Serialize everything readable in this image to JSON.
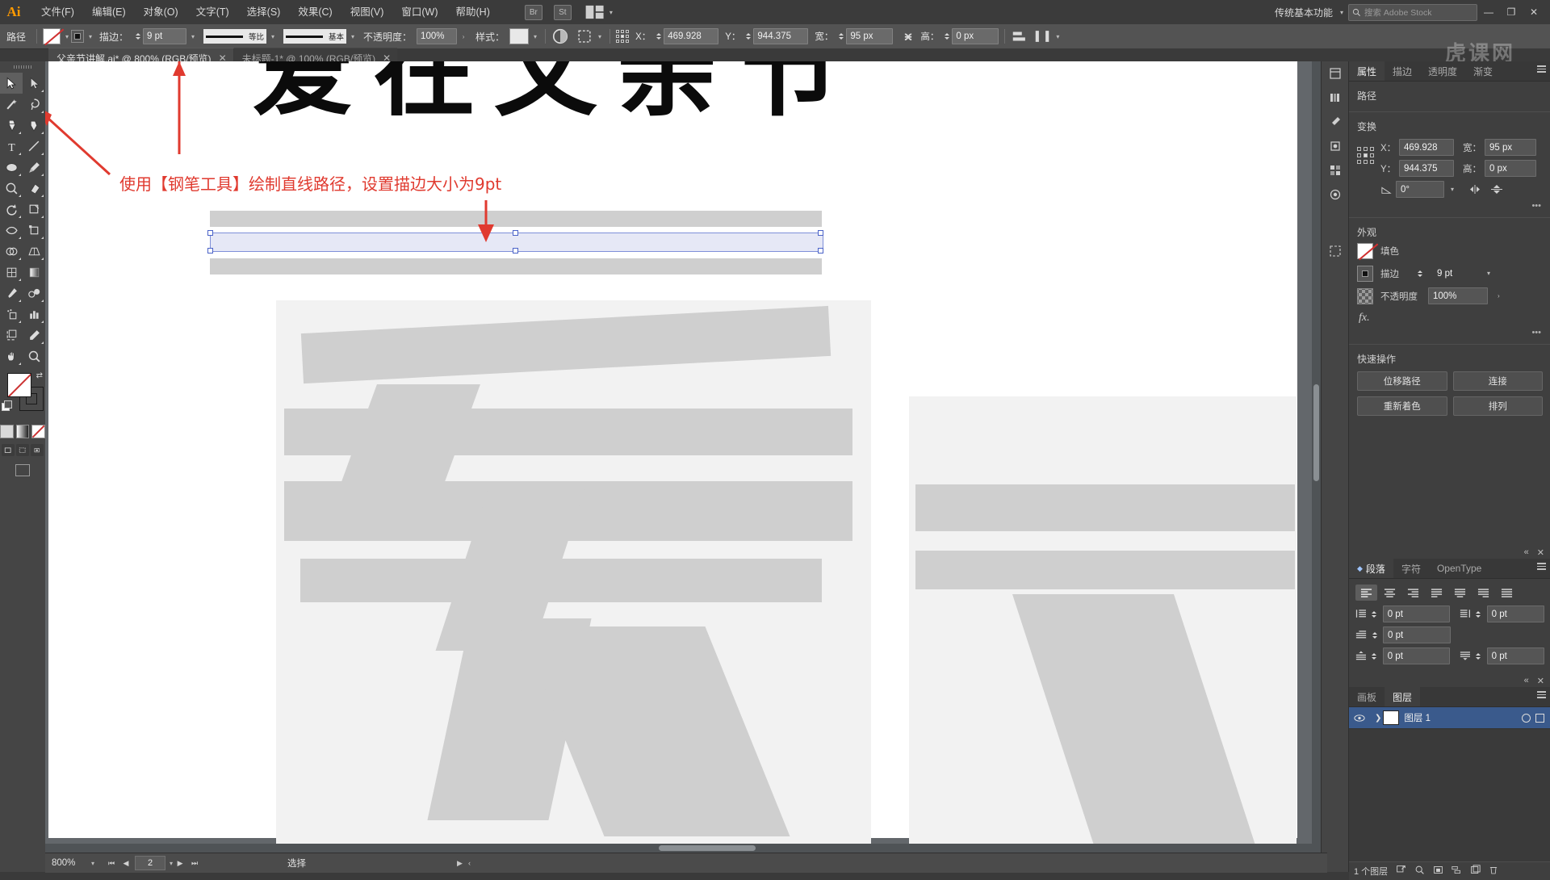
{
  "app": {
    "name": "Adobe Illustrator",
    "logo_text": "Ai",
    "workspace": "传统基本功能",
    "stock_search_placeholder": "搜索 Adobe Stock",
    "accent_color": "#ff9a00",
    "selection_color": "#4a62c8"
  },
  "menubar": {
    "items": [
      {
        "label": "文件(F)"
      },
      {
        "label": "编辑(E)"
      },
      {
        "label": "对象(O)"
      },
      {
        "label": "文字(T)"
      },
      {
        "label": "选择(S)"
      },
      {
        "label": "效果(C)"
      },
      {
        "label": "视图(V)"
      },
      {
        "label": "窗口(W)"
      },
      {
        "label": "帮助(H)"
      }
    ],
    "window_buttons": {
      "minimize": "—",
      "restore": "❐",
      "close": "✕"
    }
  },
  "controlbar": {
    "object_label": "路径",
    "fill_label": "填色",
    "stroke_label": "描边：",
    "stroke_weight": "9 pt",
    "stroke_profile": "等比",
    "brush_definition": "基本",
    "opacity_label": "不透明度：",
    "opacity_value": "100%",
    "style_label": "样式：",
    "x_label": "X：",
    "x_value": "469.928",
    "y_label": "Y：",
    "y_value": "944.375",
    "w_label": "宽：",
    "w_value": "95 px",
    "h_label": "高：",
    "h_value": "0 px"
  },
  "tabs": [
    {
      "label": "父亲节讲解.ai* @ 800% (RGB/预览)",
      "active": true,
      "close": "✕"
    },
    {
      "label": "未标题-1* @ 100% (RGB/预览)",
      "active": false,
      "close": "✕"
    }
  ],
  "toolbar": {
    "tools": [
      {
        "name": "selection-tool",
        "selected": true
      },
      {
        "name": "direct-selection-tool",
        "selected": false
      },
      {
        "name": "magic-wand-tool",
        "selected": false
      },
      {
        "name": "lasso-tool",
        "selected": false
      },
      {
        "name": "pen-tool",
        "selected": false
      },
      {
        "name": "curvature-tool",
        "selected": false
      },
      {
        "name": "type-tool",
        "selected": false
      },
      {
        "name": "line-segment-tool",
        "selected": false
      },
      {
        "name": "ellipse-tool",
        "selected": false
      },
      {
        "name": "paintbrush-tool",
        "selected": false
      },
      {
        "name": "shaper-tool",
        "selected": false
      },
      {
        "name": "eraser-tool",
        "selected": false
      },
      {
        "name": "rotate-tool",
        "selected": false
      },
      {
        "name": "scale-tool",
        "selected": false
      },
      {
        "name": "width-tool",
        "selected": false
      },
      {
        "name": "free-transform-tool",
        "selected": false
      },
      {
        "name": "shape-builder-tool",
        "selected": false
      },
      {
        "name": "perspective-grid-tool",
        "selected": false
      },
      {
        "name": "mesh-tool",
        "selected": false
      },
      {
        "name": "gradient-tool",
        "selected": false
      },
      {
        "name": "eyedropper-tool",
        "selected": false
      },
      {
        "name": "blend-tool",
        "selected": false
      },
      {
        "name": "symbol-sprayer-tool",
        "selected": false
      },
      {
        "name": "column-graph-tool",
        "selected": false
      },
      {
        "name": "artboard-tool",
        "selected": false
      },
      {
        "name": "slice-tool",
        "selected": false
      },
      {
        "name": "hand-tool",
        "selected": false
      },
      {
        "name": "zoom-tool",
        "selected": false
      }
    ],
    "fill_label": "填色",
    "stroke_label": "描边"
  },
  "canvas": {
    "annotation": "使用【钢笔工具】绘制直线路径，设置描边大小为9pt",
    "headline_chars": "爱在父亲节",
    "background_char": "爱",
    "watermark": "虎课网"
  },
  "properties_panel": {
    "tabs": [
      {
        "label": "属性",
        "active": true
      },
      {
        "label": "描边",
        "active": false
      },
      {
        "label": "透明度",
        "active": false
      },
      {
        "label": "渐变",
        "active": false
      }
    ],
    "object_type": "路径",
    "transform": {
      "title": "变换",
      "x_label": "X：",
      "x_value": "469.928",
      "y_label": "Y：",
      "y_value": "944.375",
      "w_label": "宽：",
      "w_value": "95 px",
      "h_label": "高：",
      "h_value": "0 px",
      "angle_value": "0°"
    },
    "appearance": {
      "title": "外观",
      "fill_label": "填色",
      "stroke_label": "描边",
      "stroke_value": "9 pt",
      "opacity_label": "不透明度",
      "opacity_value": "100%",
      "fx_label": "fx."
    },
    "quick_actions": {
      "title": "快速操作",
      "buttons": [
        {
          "label": "位移路径"
        },
        {
          "label": "连接"
        },
        {
          "label": "重新着色"
        },
        {
          "label": "排列"
        }
      ]
    }
  },
  "paragraph_panel": {
    "tabs": [
      {
        "label": "段落",
        "active": true
      },
      {
        "label": "字符",
        "active": false
      },
      {
        "label": "OpenType",
        "active": false
      }
    ],
    "alignment": [
      "align-left",
      "align-center",
      "align-right",
      "justify-last-left",
      "justify-last-center",
      "justify-last-right",
      "justify-all"
    ],
    "fields": [
      {
        "name": "indent-left",
        "value": "0 pt"
      },
      {
        "name": "indent-right",
        "value": "0 pt"
      },
      {
        "name": "first-line-indent",
        "value": "0 pt"
      },
      {
        "name": "space-before",
        "value": "0 pt"
      },
      {
        "name": "space-after",
        "value": "0 pt"
      }
    ]
  },
  "layers_panel": {
    "tabs": [
      {
        "label": "画板",
        "active": false
      },
      {
        "label": "图层",
        "active": true
      }
    ],
    "layers": [
      {
        "name": "图层 1",
        "visible": true,
        "selected": true
      }
    ],
    "status": "1 个图层"
  },
  "statusbar": {
    "zoom": "800%",
    "artboard_number": "2",
    "tool_status": "选择"
  }
}
